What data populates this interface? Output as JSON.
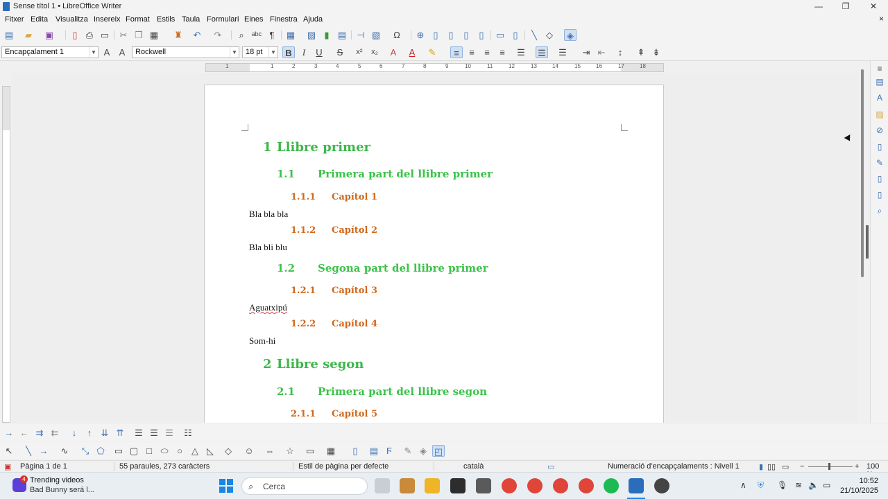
{
  "window": {
    "title": "Sense títol 1 • LibreOffice Writer",
    "minimize": "—",
    "maximize": "❐",
    "close": "✕"
  },
  "menu": [
    "Fitxer",
    "Edita",
    "Visualitza",
    "Insereix",
    "Format",
    "Estils",
    "Taula",
    "Formulari",
    "Eines",
    "Finestra",
    "Ajuda"
  ],
  "formatting": {
    "paragraph_style": "Encapçalament 1",
    "font_name": "Rockwell",
    "font_size": "18 pt"
  },
  "ruler_numbers": [
    "1",
    "1",
    "2",
    "3",
    "4",
    "5",
    "6",
    "7",
    "8",
    "9",
    "10",
    "11",
    "12",
    "13",
    "14",
    "15",
    "16",
    "17",
    "18"
  ],
  "document": {
    "colors": {
      "level1": "#3cb84a",
      "level2": "#3cc24a",
      "level3": "#d0681c"
    },
    "lines": [
      {
        "kind": "h1",
        "num": "1",
        "text": "Llibre primer"
      },
      {
        "kind": "h2",
        "num": "1.1",
        "text": "Primera part del llibre primer"
      },
      {
        "kind": "h3",
        "num": "1.1.1",
        "text": "Capítol 1"
      },
      {
        "kind": "body",
        "text": "Bla bla bla"
      },
      {
        "kind": "h3",
        "num": "1.1.2",
        "text": "Capítol 2"
      },
      {
        "kind": "body",
        "text": "Bla bli blu"
      },
      {
        "kind": "h2",
        "num": "1.2",
        "text": "Segona part del llibre primer"
      },
      {
        "kind": "h3",
        "num": "1.2.1",
        "text": "Capítol 3"
      },
      {
        "kind": "body",
        "text": "Aguatxipú"
      },
      {
        "kind": "h3",
        "num": "1.2.2",
        "text": "Capítol 4"
      },
      {
        "kind": "body",
        "text": "Som-hi"
      },
      {
        "kind": "h1",
        "num": "2",
        "text": "Llibre segon"
      },
      {
        "kind": "h2",
        "num": "2.1",
        "text": "Primera part del llibre segon"
      },
      {
        "kind": "h3",
        "num": "2.1.1",
        "text": "Capítol 5"
      }
    ]
  },
  "status": {
    "page": "Pàgina 1 de 1",
    "words": "55 paraules, 273 caràcters",
    "page_style": "Estil de pàgina per defecte",
    "language": "català",
    "outline": "Numeració d'encapçalaments : Nivell 1",
    "zoom": "100 %"
  },
  "taskbar": {
    "notification_badge": "4",
    "widget_title": "Trending videos",
    "widget_subtitle": "Bad Bunny será l...",
    "search_placeholder": "Cerca",
    "time": "10:52",
    "date": "21/10/2025"
  }
}
